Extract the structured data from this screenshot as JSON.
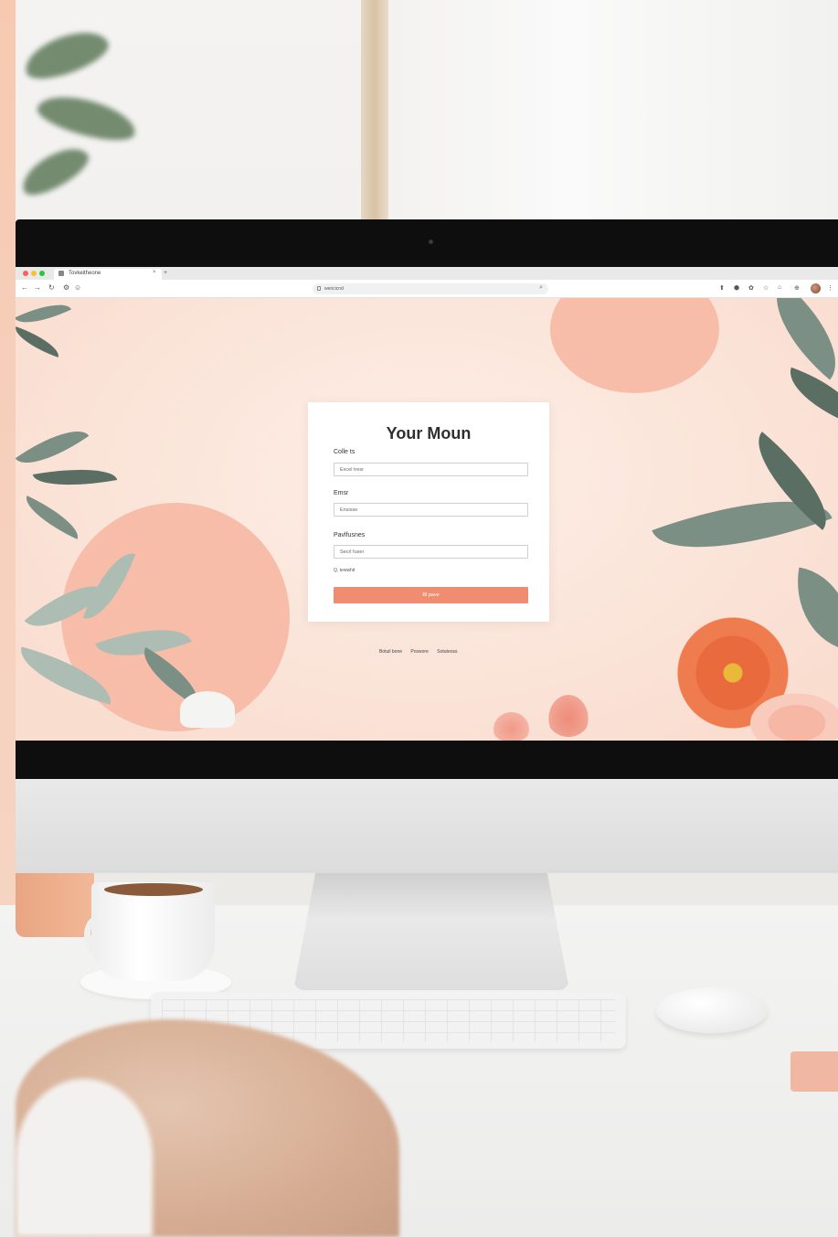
{
  "browser": {
    "tab_title": "Tovkeitheone",
    "tab_close": "×",
    "new_tab": "+",
    "url": "wencicnd",
    "nav": {
      "back": "←",
      "forward": "→",
      "reload": "↻"
    }
  },
  "form": {
    "title": "Your Moun",
    "fields": [
      {
        "label": "Colle ts",
        "placeholder": "Excel tresr"
      },
      {
        "label": "Emsr",
        "placeholder": "Ensisse"
      },
      {
        "label": "Pavlfusnes",
        "placeholder": "Secrl fuser"
      }
    ],
    "remember_label": "Q, tewwhit",
    "submit_label": "Bl pave"
  },
  "footer": {
    "links": [
      "Botuil bone",
      "Poswore",
      "Sotuteoss"
    ]
  },
  "colors": {
    "accent": "#f08c70",
    "page_bg": "#fbe6db",
    "circle": "#f7bda9",
    "leaf": "#7c8f84"
  }
}
